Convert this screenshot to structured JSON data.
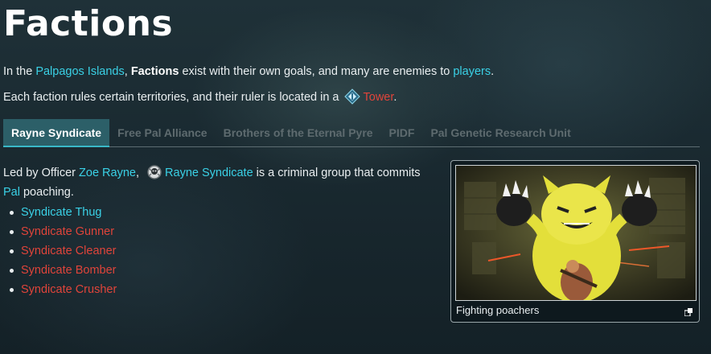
{
  "page": {
    "title": "Factions"
  },
  "intro": {
    "line1_prefix": "In the ",
    "line1_link_islands": "Palpagos Islands",
    "line1_sep": ", ",
    "line1_bold": "Factions",
    "line1_mid": " exist with their own goals, and many are enemies to ",
    "line1_link_players": "players",
    "line1_end": ".",
    "line2_prefix": "Each faction rules certain territories, and their ruler is located in a ",
    "line2_link_tower": "Tower",
    "line2_end": "."
  },
  "tabs": [
    {
      "label": "Rayne Syndicate",
      "active": true
    },
    {
      "label": "Free Pal Alliance",
      "active": false
    },
    {
      "label": "Brothers of the Eternal Pyre",
      "active": false
    },
    {
      "label": "PIDF",
      "active": false
    },
    {
      "label": "Pal Genetic Research Unit",
      "active": false
    }
  ],
  "content": {
    "desc_prefix": "Led by Officer ",
    "desc_link_leader": "Zoe Rayne",
    "desc_sep": ", ",
    "desc_link_faction": "Rayne Syndicate",
    "desc_mid": " is a criminal group that commits ",
    "desc_link_pal": "Pal",
    "desc_end": " poaching.",
    "members": [
      {
        "name": "Syndicate Thug",
        "color": "#3ad1e6"
      },
      {
        "name": "Syndicate Gunner",
        "color": "#e0443a"
      },
      {
        "name": "Syndicate Cleaner",
        "color": "#e0443a"
      },
      {
        "name": "Syndicate Bomber",
        "color": "#e0443a"
      },
      {
        "name": "Syndicate Crusher",
        "color": "#e0443a"
      }
    ]
  },
  "image_card": {
    "caption": "Fighting poachers"
  },
  "icons": {
    "tower": "tower-diamond-icon",
    "faction": "rayne-syndicate-emblem-icon",
    "expand": "expand-icon"
  },
  "colors": {
    "link": "#3ad1e6",
    "red_link": "#e0443a",
    "active_tab": "#2c5f68",
    "accent": "#39b8c8"
  }
}
